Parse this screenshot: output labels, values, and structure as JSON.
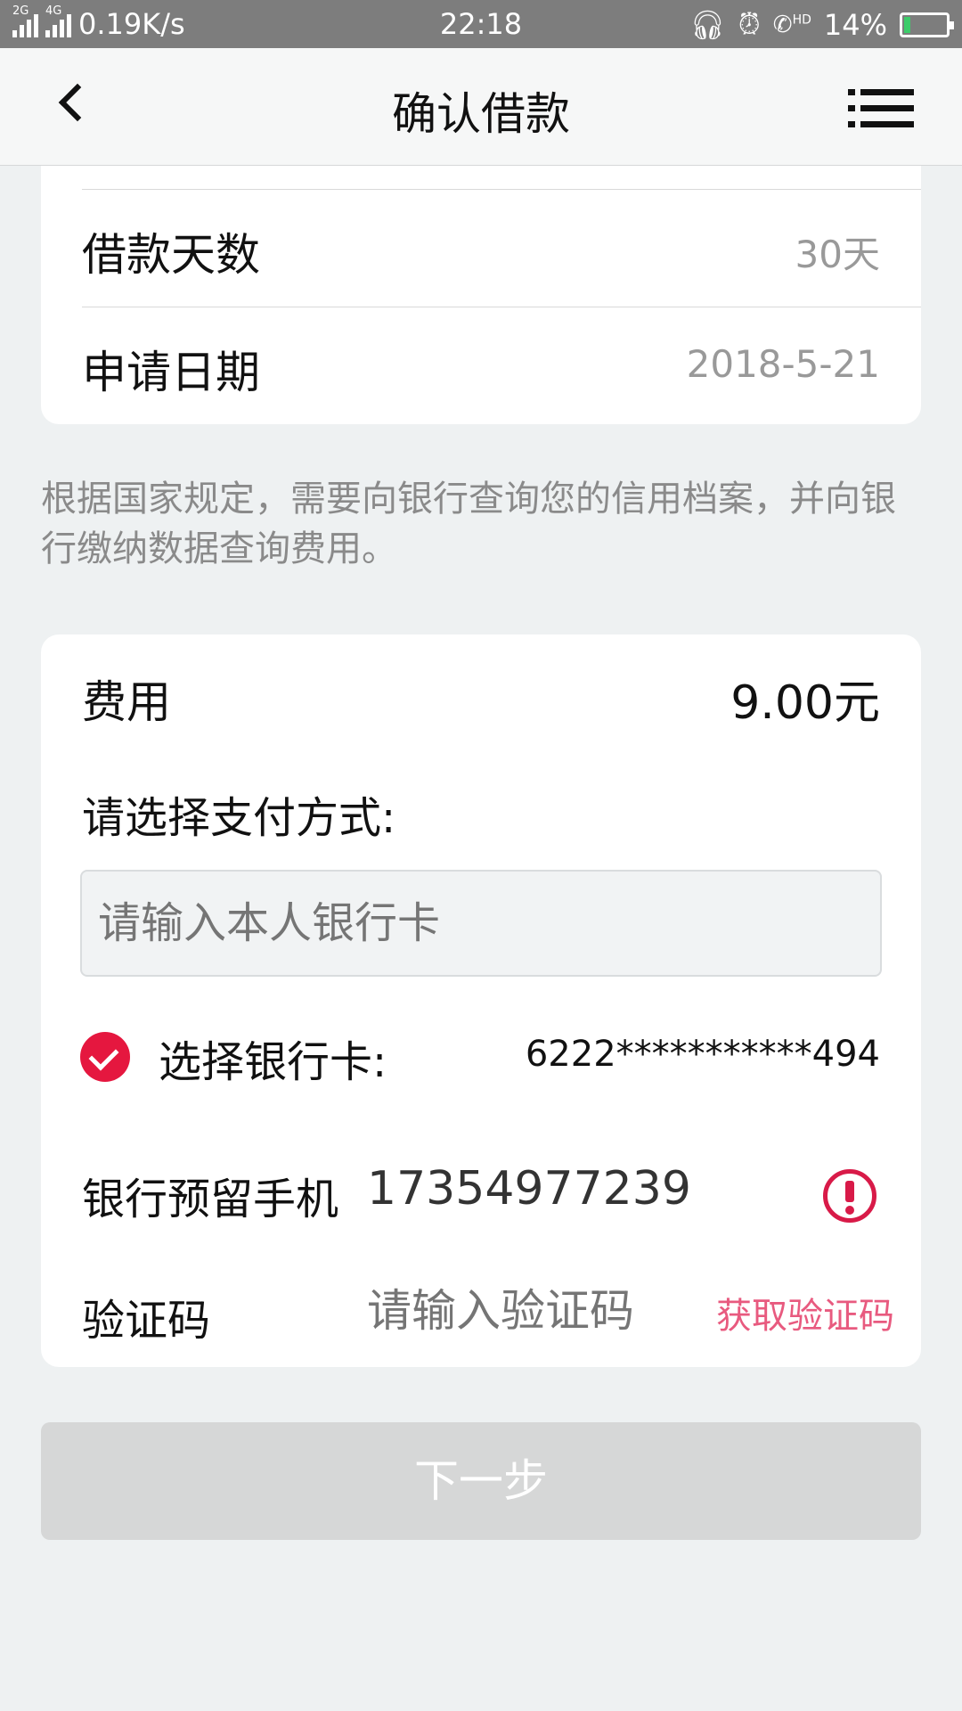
{
  "status_bar": {
    "network_speed": "0.19K/s",
    "time": "22:18",
    "battery": "14%",
    "sim1": "2G",
    "sim2": "4G",
    "hd_label": "HD"
  },
  "nav": {
    "title": "确认借款"
  },
  "loan_info": {
    "days_label": "借款天数",
    "days_value": "30天",
    "date_label": "申请日期",
    "date_value": "2018-5-21"
  },
  "notice": "根据国家规定，需要向银行查询您的信用档案，并向银行缴纳数据查询费用。",
  "payment": {
    "fee_label": "费用",
    "fee_value": "9.00元",
    "method_title": "请选择支付方式:",
    "card_input_placeholder": "请输入本人银行卡",
    "select_card_label": "选择银行卡:",
    "card_number": "6222***********494",
    "phone_label": "银行预留手机",
    "phone_number": "17354977239",
    "code_label": "验证码",
    "code_placeholder": "请输入验证码",
    "get_code_button": "获取验证码"
  },
  "next_button": "下一步",
  "colors": {
    "accent": "#e5173f",
    "get_code": "#e85a7f",
    "disabled_button": "#d6d7d7",
    "background": "#eef1f2"
  }
}
